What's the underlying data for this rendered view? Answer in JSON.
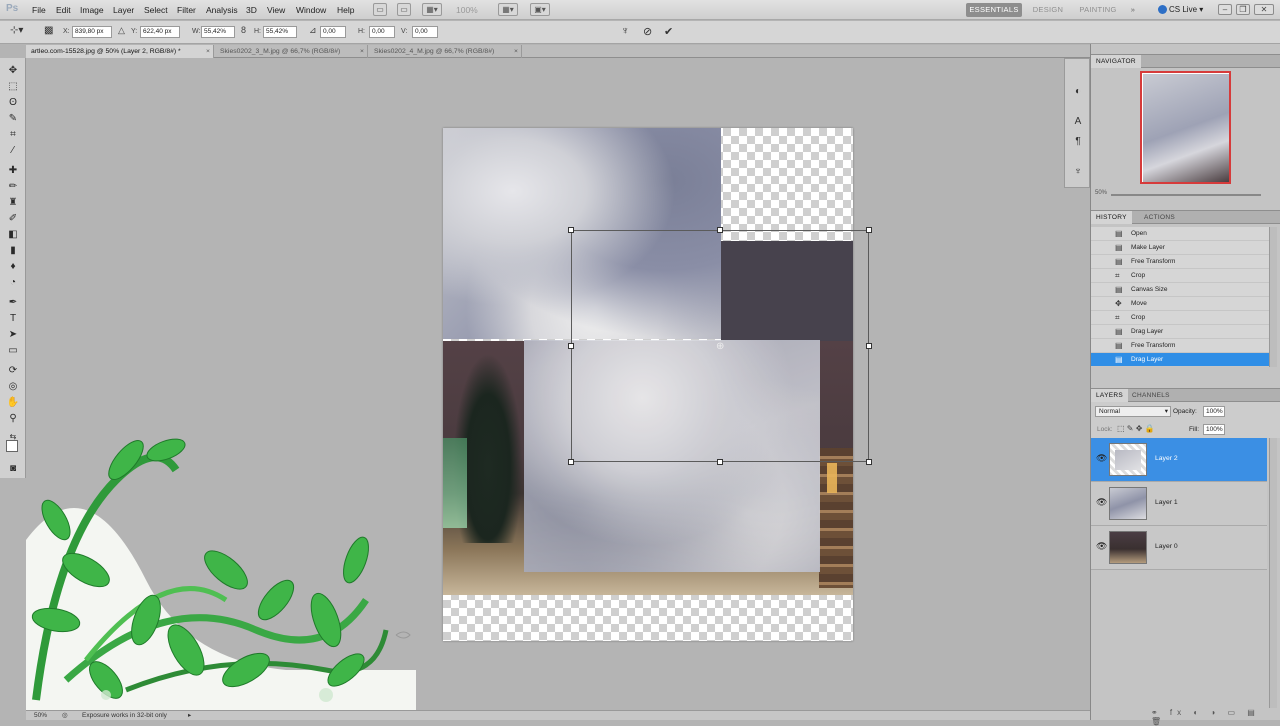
{
  "app": {
    "logo": "Ps"
  },
  "menu": [
    "File",
    "Edit",
    "Image",
    "Layer",
    "Select",
    "Filter",
    "Analysis",
    "3D",
    "View",
    "Window",
    "Help"
  ],
  "zoom_menu_value": "100%",
  "workspaces": {
    "active": "ESSENTIALS",
    "others": [
      "DESIGN",
      "PAINTING"
    ],
    "more": "»"
  },
  "cslive": "CS Live",
  "options": {
    "x_label": "X:",
    "x_value": "839,80 px",
    "y_label": "Y:",
    "y_value": "622,40 px",
    "w_label": "W:",
    "w_value": "55,42%",
    "h_label": "H:",
    "h_value": "55,42%",
    "angle_value": "0,00",
    "hskew_label": "H:",
    "hskew_value": "0,00",
    "vskew_label": "V:",
    "vskew_value": "0,00",
    "cancel_icon": "no-icon",
    "commit_icon": "check-icon"
  },
  "tabs": [
    {
      "label": "artleo.com-15528.jpg @ 50% (Layer 2, RGB/8#) *",
      "close": "×"
    },
    {
      "label": "Skies0202_3_M.jpg @ 66,7% (RGB/8#)",
      "close": "×"
    },
    {
      "label": "Skies0202_4_M.jpg @ 66,7% (RGB/8#)",
      "close": "×"
    }
  ],
  "navigator": {
    "tab": "NAVIGATOR",
    "zoom": "50%"
  },
  "history": {
    "tabs": [
      "HISTORY",
      "ACTIONS"
    ],
    "items": [
      "Open",
      "Make Layer",
      "Free Transform",
      "Crop",
      "Canvas Size",
      "Move",
      "Crop",
      "Drag Layer",
      "Free Transform",
      "Drag Layer"
    ],
    "selected_index": 9
  },
  "layers": {
    "tabs": [
      "LAYERS",
      "CHANNELS"
    ],
    "blend_mode": "Normal",
    "opacity_label": "Opacity:",
    "opacity_value": "100%",
    "lock_label": "Lock:",
    "fill_label": "Fill:",
    "fill_value": "100%",
    "items": [
      {
        "name": "Layer 2",
        "selected": true
      },
      {
        "name": "Layer 1",
        "selected": false
      },
      {
        "name": "Layer 0",
        "selected": false
      }
    ]
  },
  "status": {
    "zoom": "50%",
    "message": "Exposure works in 32-bit only"
  }
}
